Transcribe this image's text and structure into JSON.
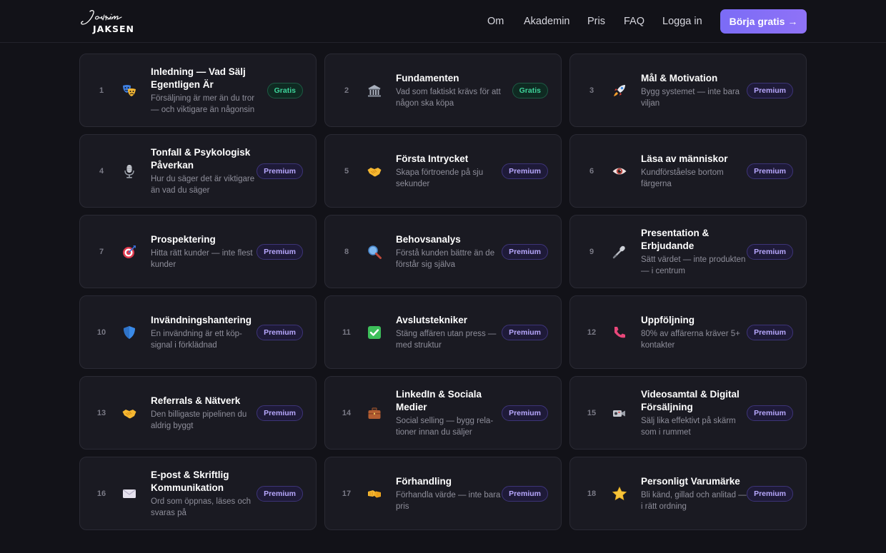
{
  "header": {
    "logo_script": "Joakim",
    "logo_word": "JAKSEN",
    "nav": [
      "Om",
      "Akademin",
      "Pris",
      "FAQ",
      "Logga in"
    ],
    "cta": "Börja gratis →"
  },
  "colors": {
    "background": "#121218",
    "card": "#1a1a22",
    "accent": "#7b6cf6",
    "free_badge": "#3ed39a",
    "premium_badge": "#b8a8ff"
  },
  "modules": [
    {
      "num": "1",
      "icon": "theater-masks-icon",
      "title": "Inledning — Vad Sälj Egentligen Är",
      "desc": "Försäljning är mer än du tror — och viktigare än någonsin",
      "badge": "Gratis",
      "tier": "free"
    },
    {
      "num": "2",
      "icon": "classical-building-icon",
      "title": "Fundamenten",
      "desc": "Vad som faktiskt krävs för att någon ska köpa",
      "badge": "Gratis",
      "tier": "free"
    },
    {
      "num": "3",
      "icon": "rocket-icon",
      "title": "Mål & Motivation",
      "desc": "Bygg systemet — inte bara viljan",
      "badge": "Premium",
      "tier": "premium"
    },
    {
      "num": "4",
      "icon": "microphone-icon",
      "title": "Tonfall & Psykologisk Påverkan",
      "desc": "Hur du säger det är vikti­gare än vad du säger",
      "badge": "Premium",
      "tier": "premium"
    },
    {
      "num": "5",
      "icon": "handshake-icon",
      "title": "Första Intrycket",
      "desc": "Skapa förtroende på sju sekunder",
      "badge": "Premium",
      "tier": "premium"
    },
    {
      "num": "6",
      "icon": "eye-icon",
      "title": "Läsa av människor",
      "desc": "Kundförståelse bortom färgerna",
      "badge": "Premium",
      "tier": "premium"
    },
    {
      "num": "7",
      "icon": "target-icon",
      "title": "Prospektering",
      "desc": "Hitta rätt kunder — inte flest kunder",
      "badge": "Premium",
      "tier": "premium"
    },
    {
      "num": "8",
      "icon": "magnifier-icon",
      "title": "Behovsanalys",
      "desc": "Förstå kunden bättre än de förstår sig själva",
      "badge": "Premium",
      "tier": "premium"
    },
    {
      "num": "9",
      "icon": "microphone-stand-icon",
      "title": "Presentation & Erbjudande",
      "desc": "Sätt värdet — inte produk­ten — i centrum",
      "badge": "Premium",
      "tier": "premium"
    },
    {
      "num": "10",
      "icon": "shield-icon",
      "title": "Invändningshante­ring",
      "desc": "En invändning är ett köp­signal i förklädnad",
      "badge": "Premium",
      "tier": "premium"
    },
    {
      "num": "11",
      "icon": "check-mark-icon",
      "title": "Avslutstekniker",
      "desc": "Stäng affären utan press — med struktur",
      "badge": "Premium",
      "tier": "premium"
    },
    {
      "num": "12",
      "icon": "phone-icon",
      "title": "Uppföljning",
      "desc": "80% av affärerna kräver 5+ kontakter",
      "badge": "Premium",
      "tier": "premium"
    },
    {
      "num": "13",
      "icon": "handshake-icon",
      "title": "Referrals & Nätverk",
      "desc": "Den billigaste pipelinen du aldrig byggt",
      "badge": "Premium",
      "tier": "premium"
    },
    {
      "num": "14",
      "icon": "briefcase-icon",
      "title": "LinkedIn & Sociala Medier",
      "desc": "Social selling — bygg rela­tioner innan du säljer",
      "badge": "Premium",
      "tier": "premium"
    },
    {
      "num": "15",
      "icon": "video-camera-icon",
      "title": "Videosamtal & Digi­tal Försäljning",
      "desc": "Sälj lika effektivt på skärm som i rummet",
      "badge": "Premium",
      "tier": "premium"
    },
    {
      "num": "16",
      "icon": "envelope-icon",
      "title": "E-post & Skriftlig Kommunikation",
      "desc": "Ord som öppnas, läses och svaras på",
      "badge": "Premium",
      "tier": "premium"
    },
    {
      "num": "17",
      "icon": "fist-bump-icon",
      "title": "Förhandling",
      "desc": "Förhandla värde — inte bara pris",
      "badge": "Premium",
      "tier": "premium"
    },
    {
      "num": "18",
      "icon": "star-icon",
      "title": "Personligt Varumärke",
      "desc": "Bli känd, gillad och anlitad — i rätt ordning",
      "badge": "Premium",
      "tier": "premium"
    }
  ]
}
